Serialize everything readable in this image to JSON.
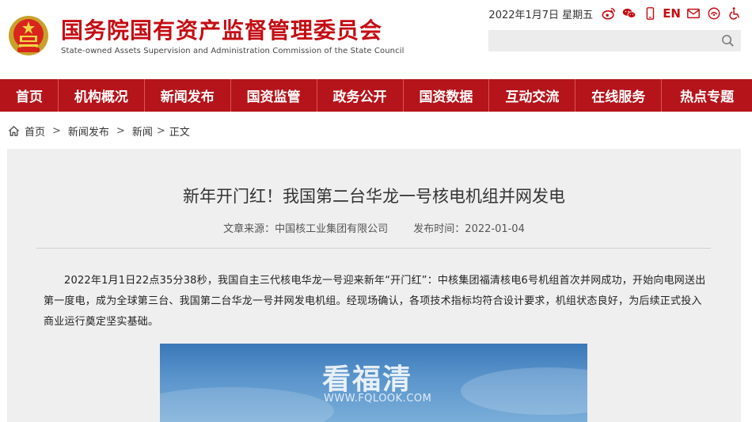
{
  "header": {
    "title": "国务院国有资产监督管理委员会",
    "subtitle": "State-owned Assets Supervision and Administration Commission of the State Council",
    "date": "2022年1月7日  星期五",
    "en_label": "EN",
    "icons": [
      "weibo-icon",
      "wechat-icon",
      "mobile-icon",
      "en-link",
      "mail-icon",
      "accessibility-care-icon",
      "wheelchair-icon"
    ],
    "search": {
      "placeholder": "",
      "value": ""
    }
  },
  "nav": {
    "items": [
      "首页",
      "机构概况",
      "新闻发布",
      "国资监管",
      "政务公开",
      "国资数据",
      "互动交流",
      "在线服务",
      "热点专题"
    ]
  },
  "breadcrumb": {
    "items": [
      "首页",
      "新闻发布",
      "新闻",
      "正文"
    ],
    "separator": ">"
  },
  "article": {
    "title": "新年开门红！我国第二台华龙一号核电机组并网发电",
    "source": "文章来源：中国核工业集团有限公司",
    "publish_time": "发布时间：2022-01-04",
    "paragraph": "2022年1月1日22点35分38秒，我国自主三代核电华龙一号迎来新年“开门红”：中核集团福清核电6号机组首次并网成功，开始向电网送出第一度电，成为全球第三台、我国第二台华龙一号并网发电机组。经现场确认，各项技术指标均符合设计要求，机组状态良好，为后续正式投入商业运行奠定坚实基础。",
    "image_watermark": "看福清",
    "image_watermark_url": "WWW.FQLOOK.COM"
  },
  "colors": {
    "brand_red": "#c40d13",
    "nav_bg": "#b5141a",
    "article_bg": "#efefef"
  }
}
